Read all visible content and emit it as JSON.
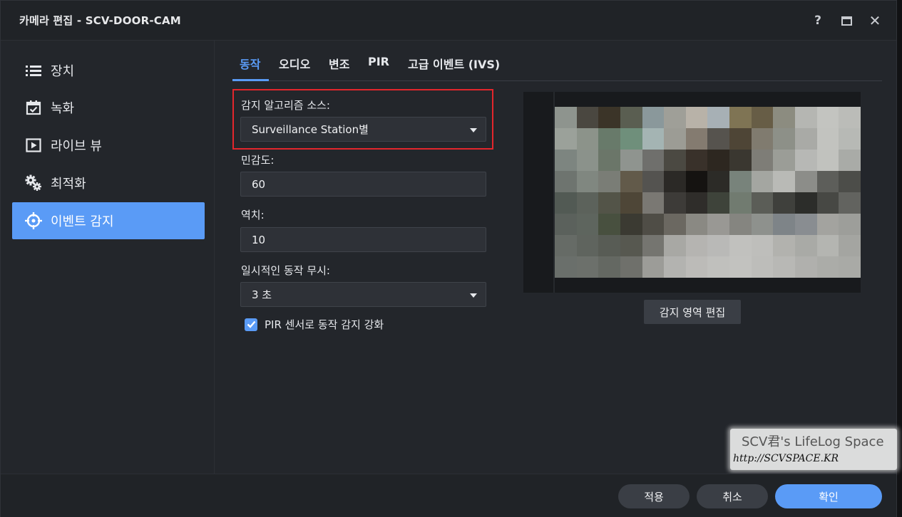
{
  "window": {
    "title": "카메라 편집 - SCV-DOOR-CAM",
    "help_label": "?",
    "close_label": "✕"
  },
  "sidebar": {
    "items": [
      {
        "label": "장치",
        "icon": "list-icon",
        "active": false
      },
      {
        "label": "녹화",
        "icon": "calendar-check-icon",
        "active": false
      },
      {
        "label": "라이브 뷰",
        "icon": "play-icon",
        "active": false
      },
      {
        "label": "최적화",
        "icon": "gears-icon",
        "active": false
      },
      {
        "label": "이벤트 감지",
        "icon": "crosshair-icon",
        "active": true
      }
    ]
  },
  "tabs": [
    {
      "label": "동작",
      "active": true
    },
    {
      "label": "오디오",
      "active": false
    },
    {
      "label": "변조",
      "active": false
    },
    {
      "label": "PIR",
      "active": false
    },
    {
      "label": "고급 이벤트 (IVS)",
      "active": false
    }
  ],
  "form": {
    "algorithm_label": "감지 알고리즘 소스:",
    "algorithm_value": "Surveillance Station별",
    "sensitivity_label": "민감도:",
    "sensitivity_value": "60",
    "threshold_label": "역치:",
    "threshold_value": "10",
    "ignore_label": "일시적인 동작 무시:",
    "ignore_value": "3 초",
    "pir_checkbox_label": "PIR 센서로 동작 감지 강화",
    "pir_checked": true
  },
  "preview": {
    "edit_area_label": "감지 영역 편집"
  },
  "watermark": {
    "line1": "SCV君's LifeLog Space",
    "line2": "http://SCVSPACE.KR"
  },
  "footer": {
    "apply_label": "적용",
    "cancel_label": "취소",
    "ok_label": "확인"
  },
  "colors": {
    "accent": "#5a9bf6",
    "highlight_frame": "#e3262c",
    "background": "#23262b"
  }
}
